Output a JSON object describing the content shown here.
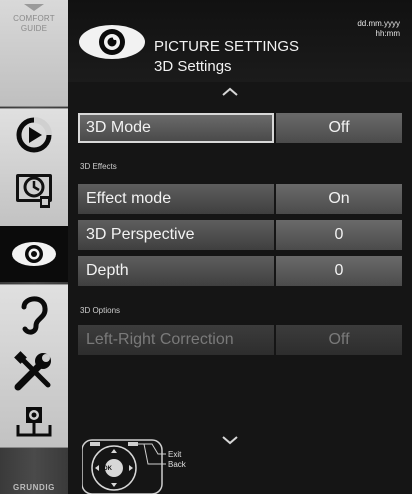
{
  "sidebar": {
    "comfort_guide": "COMFORT\nGUIDE",
    "brand": "GRUNDIG",
    "icons": [
      "source-icon",
      "timer-settings-icon",
      "picture-eye-icon",
      "sound-ear-icon",
      "tools-icon",
      "network-icon"
    ]
  },
  "header": {
    "title": "PICTURE SETTINGS",
    "subtitle": "3D Settings",
    "date": "dd.mm.yyyy",
    "time": "hh:mm"
  },
  "menu": {
    "mode": {
      "label": "3D Mode",
      "value": "Off"
    },
    "effects_heading": "3D Effects",
    "effect_mode": {
      "label": "Effect mode",
      "value": "On"
    },
    "perspective": {
      "label": "3D Perspective",
      "value": "0"
    },
    "depth": {
      "label": "Depth",
      "value": "0"
    },
    "options_heading": "3D Options",
    "lr_correction": {
      "label": "Left-Right Correction",
      "value": "Off"
    }
  },
  "remote": {
    "ok_label": "OK",
    "exit_label": "Exit",
    "back_label": "Back"
  },
  "colors": {
    "background": "#151515",
    "row_label": "#4f4f4f",
    "row_value": "#5a5a5a",
    "selected_border": "#d8d8d8",
    "text": "#f2f2f2",
    "disabled_text": "#7a7a7a"
  }
}
